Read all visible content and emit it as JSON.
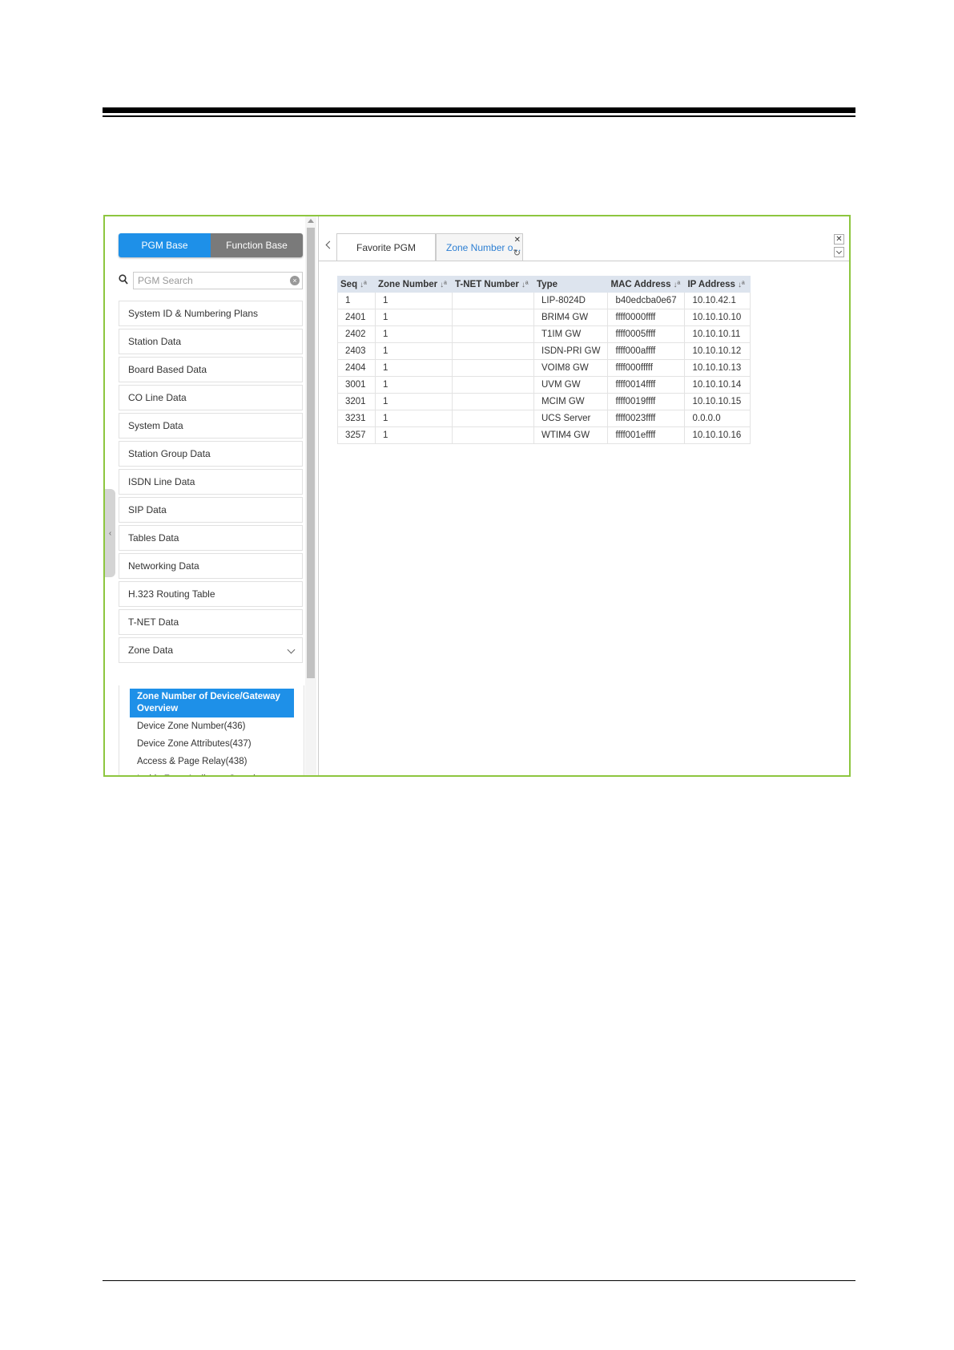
{
  "left_panel": {
    "base_tabs": [
      "PGM Base",
      "Function Base"
    ],
    "search_placeholder": "PGM Search",
    "menu_items": [
      "System ID & Numbering Plans",
      "Station Data",
      "Board Based Data",
      "CO Line Data",
      "System Data",
      "Station Group Data",
      "ISDN Line Data",
      "SIP Data",
      "Tables Data",
      "Networking Data",
      "H.323 Routing Table",
      "T-NET Data",
      "Zone Data"
    ],
    "submenu_items": [
      "Zone Number of Device/Gateway Overview",
      "Device Zone Number(436)",
      "Device Zone Attributes(437)",
      "Access & Page Relay(438)",
      "Inside Zone Attributes Overview"
    ]
  },
  "tabs": {
    "favorite": "Favorite PGM",
    "active": "Zone Number o..."
  },
  "table": {
    "columns": [
      "Seq",
      "Zone Number",
      "T-NET Number",
      "Type",
      "MAC Address",
      "IP Address"
    ],
    "rows": [
      [
        "1",
        "1",
        "",
        "LIP-8024D",
        "b40edcba0e67",
        "10.10.42.1"
      ],
      [
        "2401",
        "1",
        "",
        "BRIM4 GW",
        "ffff0000ffff",
        "10.10.10.10"
      ],
      [
        "2402",
        "1",
        "",
        "T1IM GW",
        "ffff0005ffff",
        "10.10.10.11"
      ],
      [
        "2403",
        "1",
        "",
        "ISDN-PRI GW",
        "ffff000affff",
        "10.10.10.12"
      ],
      [
        "2404",
        "1",
        "",
        "VOIM8 GW",
        "ffff000fffff",
        "10.10.10.13"
      ],
      [
        "3001",
        "1",
        "",
        "UVM GW",
        "ffff0014ffff",
        "10.10.10.14"
      ],
      [
        "3201",
        "1",
        "",
        "MCIM GW",
        "ffff0019ffff",
        "10.10.10.15"
      ],
      [
        "3231",
        "1",
        "",
        "UCS Server",
        "ffff0023ffff",
        "0.0.0.0"
      ],
      [
        "3257",
        "1",
        "",
        "WTIM4 GW",
        "ffff001effff",
        "10.10.10.16"
      ]
    ]
  },
  "colors": {
    "accent": "#1e90e8",
    "frame_border": "#8dc63f",
    "header_bg": "#dde4ee"
  }
}
